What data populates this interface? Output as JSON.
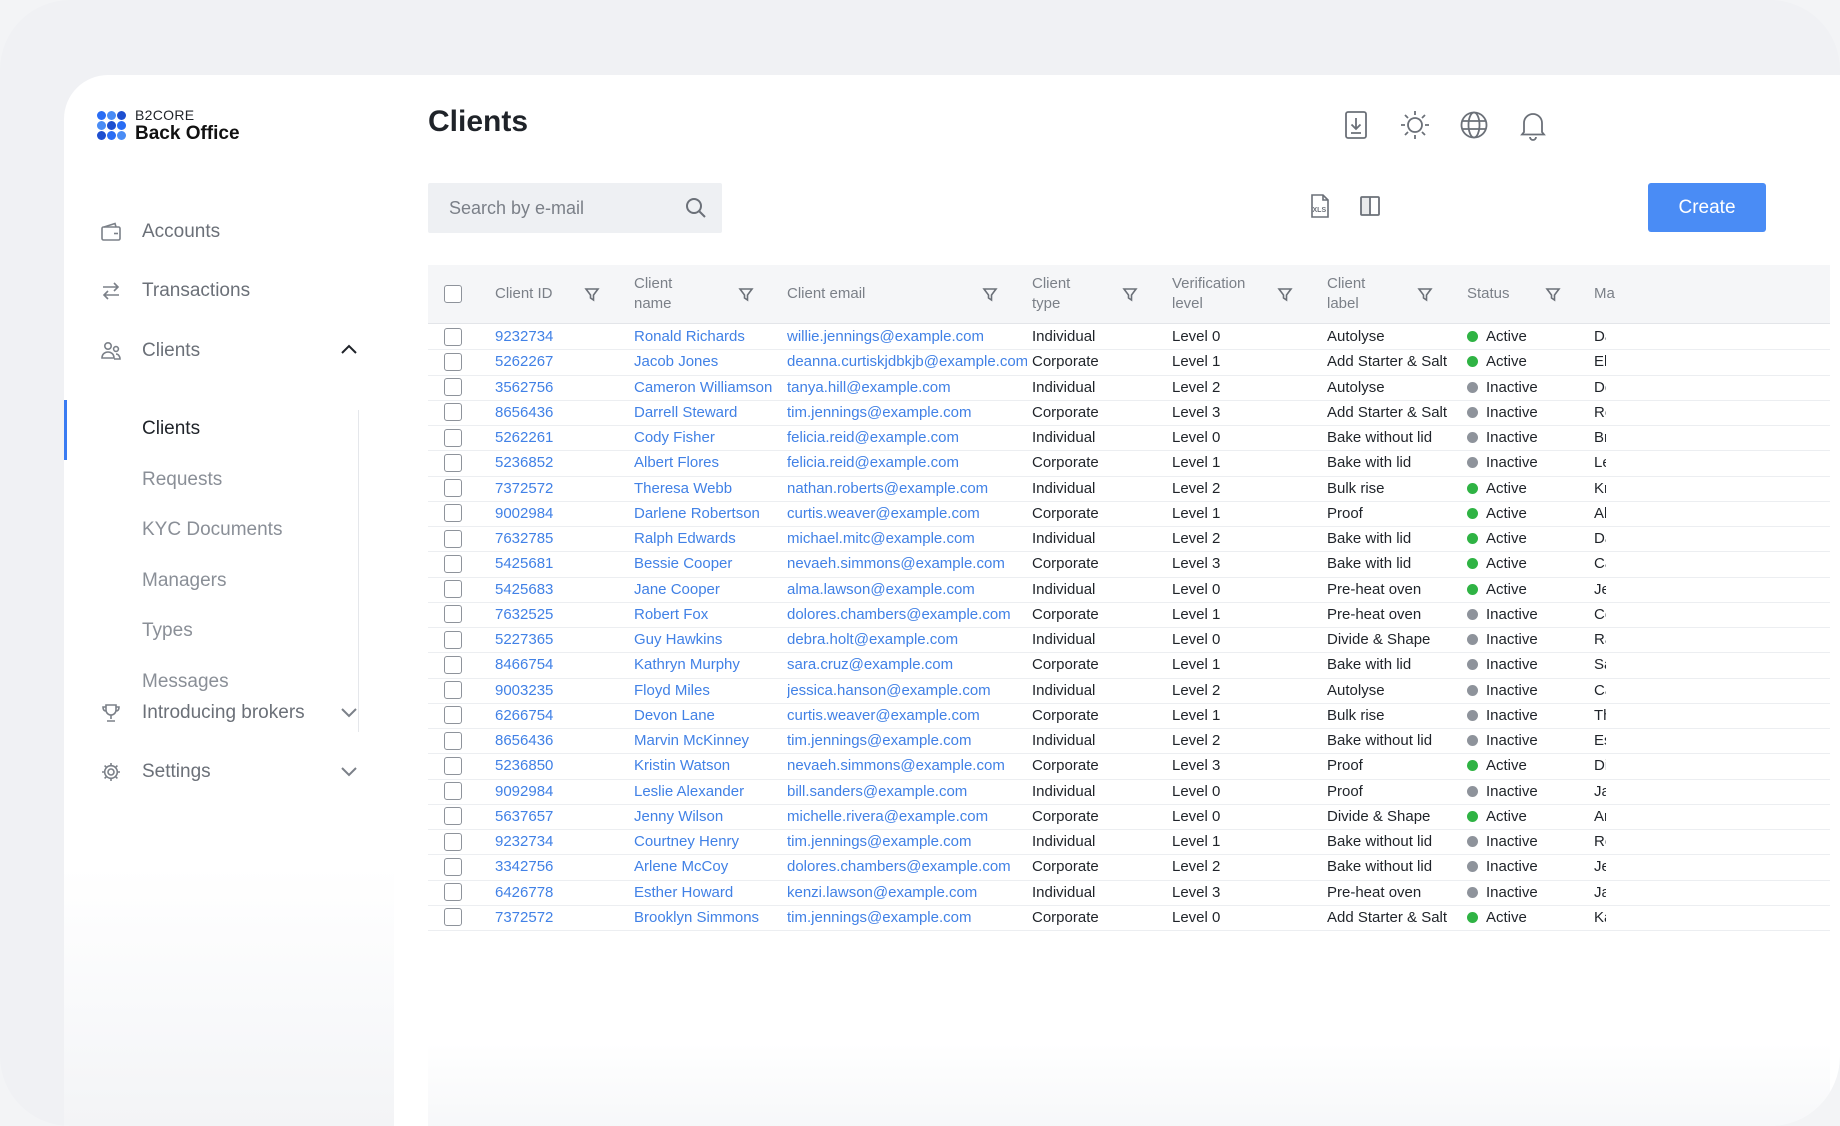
{
  "app": {
    "logo_small": "B2CORE",
    "logo_big": "Back Office",
    "page_title": "Clients"
  },
  "sidebar": {
    "accounts": "Accounts",
    "transactions": "Transactions",
    "clients": "Clients",
    "sub_items": [
      "Clients",
      "Requests",
      "KYC Documents",
      "Managers",
      "Types",
      "Messages"
    ],
    "introducing_brokers": "Introducing brokers",
    "settings": "Settings"
  },
  "header_icons": [
    "download-icon",
    "sun-icon",
    "globe-icon",
    "bell-icon"
  ],
  "toolbar": {
    "search_placeholder": "Search by e-mail",
    "create_label": "Create",
    "icons": [
      "xls-export-icon",
      "columns-icon"
    ]
  },
  "table": {
    "columns": [
      "Client ID",
      "Client name",
      "Client email",
      "Client type",
      "Verification level",
      "Client label",
      "Status",
      "Ma"
    ],
    "rows": [
      {
        "id": "9232734",
        "name": "Ronald Richards",
        "email": "willie.jennings@example.com",
        "type": "Individual",
        "level": "Level 0",
        "label": "Autolyse",
        "status": "Active",
        "extra": "Da"
      },
      {
        "id": "5262267",
        "name": "Jacob Jones",
        "email": "deanna.curtiskjdbkjb@example.com",
        "type": "Corporate",
        "level": "Level 1",
        "label": "Add Starter & Salt",
        "status": "Active",
        "extra": "El"
      },
      {
        "id": "3562756",
        "name": "Cameron Williamson",
        "email": "tanya.hill@example.com",
        "type": "Individual",
        "level": "Level 2",
        "label": "Autolyse",
        "status": "Inactive",
        "extra": "De"
      },
      {
        "id": "8656436",
        "name": "Darrell Steward",
        "email": "tim.jennings@example.com",
        "type": "Corporate",
        "level": "Level 3",
        "label": "Add Starter & Salt",
        "status": "Inactive",
        "extra": "Ro"
      },
      {
        "id": "5262261",
        "name": "Cody Fisher",
        "email": "felicia.reid@example.com",
        "type": "Individual",
        "level": "Level 0",
        "label": "Bake without lid",
        "status": "Inactive",
        "extra": "Br"
      },
      {
        "id": "5236852",
        "name": "Albert Flores",
        "email": "felicia.reid@example.com",
        "type": "Corporate",
        "level": "Level 1",
        "label": "Bake with lid",
        "status": "Inactive",
        "extra": "Le"
      },
      {
        "id": "7372572",
        "name": "Theresa Webb",
        "email": "nathan.roberts@example.com",
        "type": "Individual",
        "level": "Level 2",
        "label": "Bulk rise",
        "status": "Active",
        "extra": "Kr"
      },
      {
        "id": "9002984",
        "name": "Darlene Robertson",
        "email": "curtis.weaver@example.com",
        "type": "Corporate",
        "level": "Level 1",
        "label": "Proof",
        "status": "Active",
        "extra": "Al"
      },
      {
        "id": "7632785",
        "name": "Ralph Edwards",
        "email": "michael.mitc@example.com",
        "type": "Individual",
        "level": "Level 2",
        "label": "Bake with lid",
        "status": "Active",
        "extra": "Da"
      },
      {
        "id": "5425681",
        "name": "Bessie Cooper",
        "email": "nevaeh.simmons@example.com",
        "type": "Corporate",
        "level": "Level 3",
        "label": "Bake with lid",
        "status": "Active",
        "extra": "Ca"
      },
      {
        "id": "5425683",
        "name": "Jane Cooper",
        "email": "alma.lawson@example.com",
        "type": "Individual",
        "level": "Level 0",
        "label": "Pre-heat oven",
        "status": "Active",
        "extra": "Je"
      },
      {
        "id": "7632525",
        "name": "Robert Fox",
        "email": "dolores.chambers@example.com",
        "type": "Corporate",
        "level": "Level 1",
        "label": "Pre-heat oven",
        "status": "Inactive",
        "extra": "Co"
      },
      {
        "id": "5227365",
        "name": "Guy Hawkins",
        "email": "debra.holt@example.com",
        "type": "Individual",
        "level": "Level 0",
        "label": "Divide & Shape",
        "status": "Inactive",
        "extra": "Ra"
      },
      {
        "id": "8466754",
        "name": "Kathryn Murphy",
        "email": "sara.cruz@example.com",
        "type": "Corporate",
        "level": "Level 1",
        "label": "Bake with lid",
        "status": "Inactive",
        "extra": "Sa"
      },
      {
        "id": "9003235",
        "name": "Floyd Miles",
        "email": "jessica.hanson@example.com",
        "type": "Individual",
        "level": "Level 2",
        "label": "Autolyse",
        "status": "Inactive",
        "extra": "Ca"
      },
      {
        "id": "6266754",
        "name": "Devon Lane",
        "email": "curtis.weaver@example.com",
        "type": "Corporate",
        "level": "Level 1",
        "label": "Bulk rise",
        "status": "Inactive",
        "extra": "Th"
      },
      {
        "id": "8656436",
        "name": "Marvin McKinney",
        "email": "tim.jennings@example.com",
        "type": "Individual",
        "level": "Level 2",
        "label": "Bake without lid",
        "status": "Inactive",
        "extra": "Es"
      },
      {
        "id": "5236850",
        "name": "Kristin Watson",
        "email": "nevaeh.simmons@example.com",
        "type": "Corporate",
        "level": "Level 3",
        "label": "Proof",
        "status": "Active",
        "extra": "Di"
      },
      {
        "id": "9092984",
        "name": "Leslie Alexander",
        "email": "bill.sanders@example.com",
        "type": "Individual",
        "level": "Level 0",
        "label": "Proof",
        "status": "Inactive",
        "extra": "Ja"
      },
      {
        "id": "5637657",
        "name": "Jenny Wilson",
        "email": "michelle.rivera@example.com",
        "type": "Corporate",
        "level": "Level 0",
        "label": "Divide & Shape",
        "status": "Active",
        "extra": "Ar"
      },
      {
        "id": "9232734",
        "name": "Courtney Henry",
        "email": "tim.jennings@example.com",
        "type": "Individual",
        "level": "Level 1",
        "label": "Bake without lid",
        "status": "Inactive",
        "extra": "Ro"
      },
      {
        "id": "3342756",
        "name": "Arlene McCoy",
        "email": "dolores.chambers@example.com",
        "type": "Corporate",
        "level": "Level 2",
        "label": "Bake without lid",
        "status": "Inactive",
        "extra": "Je"
      },
      {
        "id": "6426778",
        "name": "Esther Howard",
        "email": "kenzi.lawson@example.com",
        "type": "Individual",
        "level": "Level 3",
        "label": "Pre-heat oven",
        "status": "Inactive",
        "extra": "Ja"
      },
      {
        "id": "7372572",
        "name": "Brooklyn Simmons",
        "email": "tim.jennings@example.com",
        "type": "Corporate",
        "level": "Level 0",
        "label": "Add Starter & Salt",
        "status": "Active",
        "extra": "Ka"
      }
    ]
  },
  "colors": {
    "accent": "#4a8cf5",
    "link": "#4181e6",
    "active": "#2fb344",
    "inactive": "#8e939b"
  }
}
